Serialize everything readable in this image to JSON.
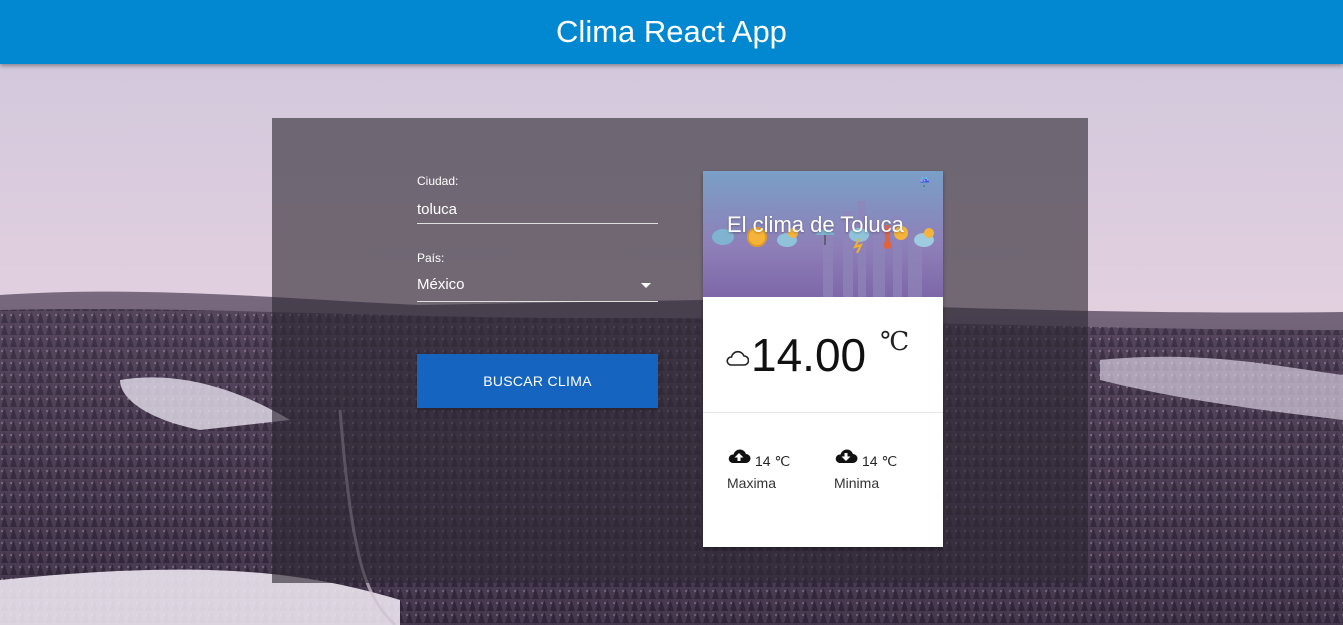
{
  "app": {
    "title": "Clima React App"
  },
  "form": {
    "city_label": "Ciudad:",
    "city_value": "toluca",
    "country_label": "País:",
    "country_value": "México",
    "submit_label": "BUSCAR CLIMA"
  },
  "card": {
    "title": "El clima de Toluca",
    "temperature": "14.00",
    "unit": "℃",
    "max_temp": "14 ℃",
    "max_label": "Maxima",
    "min_temp": "14 ℃",
    "min_label": "Minima",
    "icons": [
      "cloud-icon",
      "cloud-upload-icon",
      "cloud-download-icon"
    ]
  },
  "colors": {
    "appbar": "#0288d1",
    "button": "#1565c0",
    "card": "#ffffff"
  }
}
